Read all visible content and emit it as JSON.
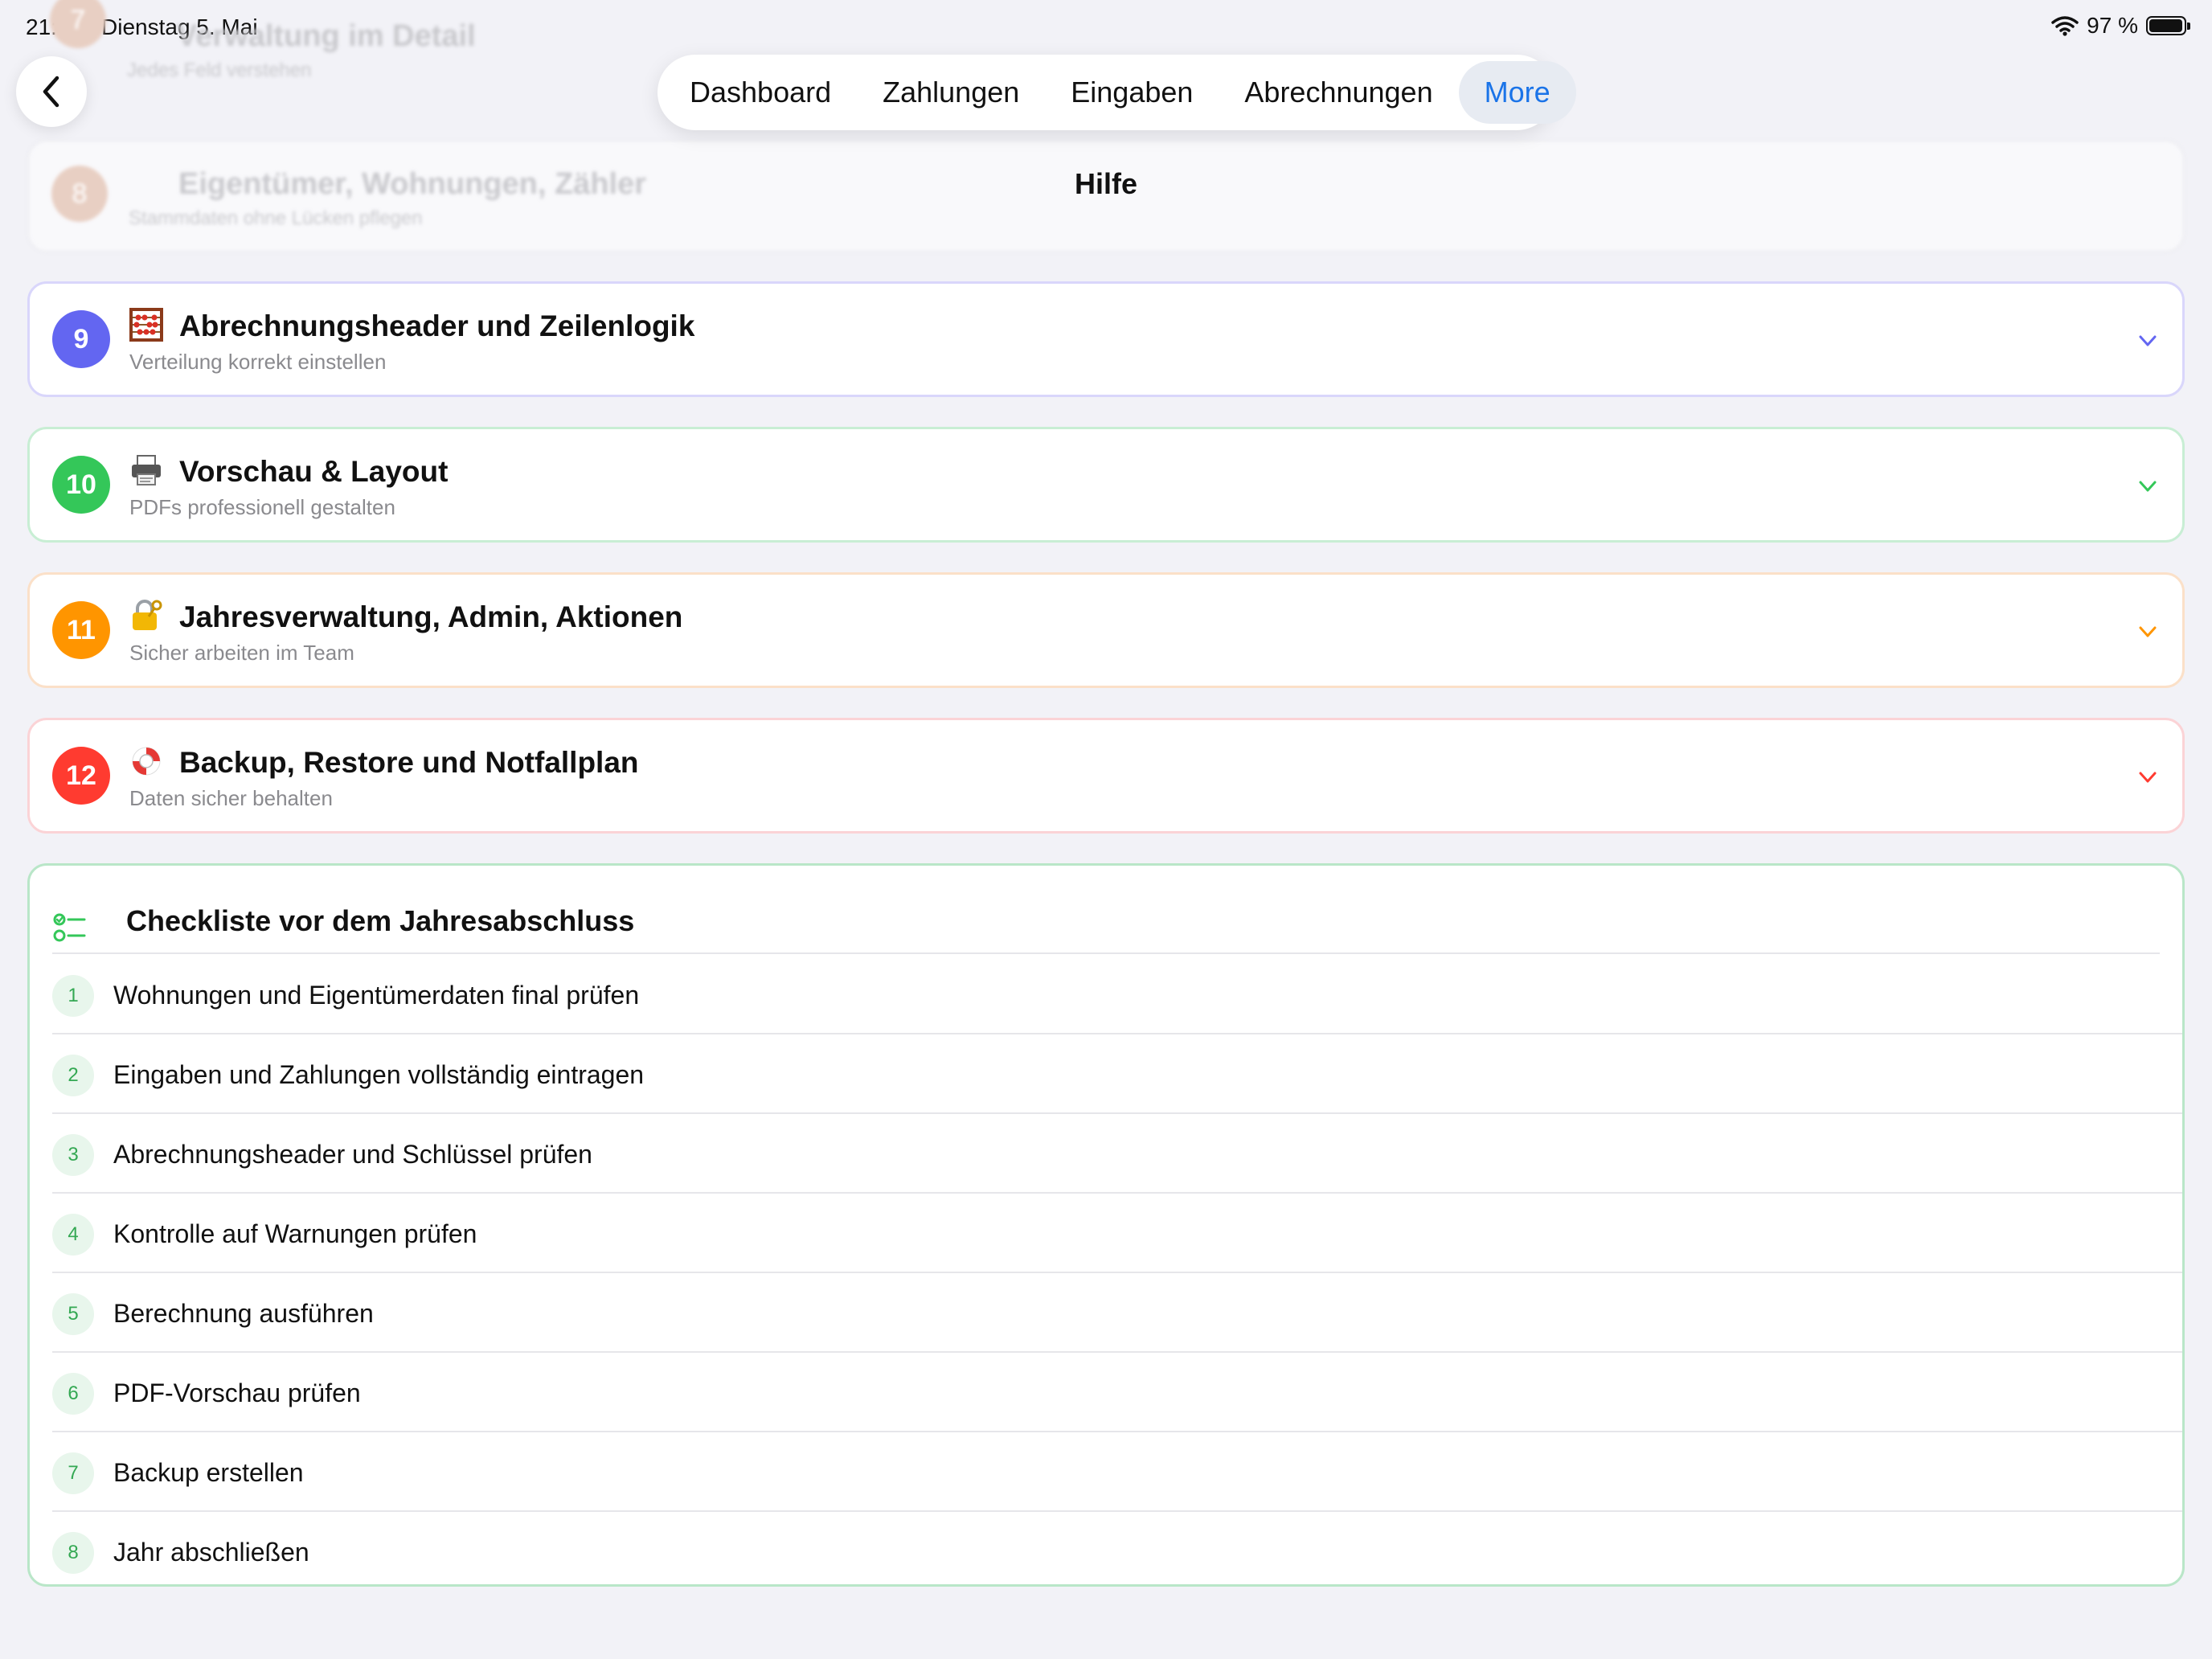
{
  "status": {
    "time": "21:58",
    "date": "Dienstag 5. Mai",
    "battery": "97 %",
    "battery_level": 0.97
  },
  "tabs": [
    {
      "label": "Dashboard"
    },
    {
      "label": "Zahlungen"
    },
    {
      "label": "Eingaben"
    },
    {
      "label": "Abrechnungen"
    },
    {
      "label": "More",
      "active": true
    }
  ],
  "page": {
    "title": "Hilfe"
  },
  "ghost_sections": [
    {
      "number": "7",
      "title": "Verwaltung im Detail",
      "subtitle": "Jedes Feld verstehen"
    },
    {
      "number": "8",
      "title": "Eigentümer, Wohnungen, Zähler",
      "subtitle": "Stammdaten ohne Lücken pflegen"
    }
  ],
  "sections": [
    {
      "number": "9",
      "icon": "abacus-icon",
      "title": "Abrechnungsheader und Zeilenlogik",
      "subtitle": "Verteilung korrekt einstellen",
      "color": "#6366f1",
      "border": "#d9d6fb"
    },
    {
      "number": "10",
      "icon": "printer-icon",
      "title": "Vorschau & Layout",
      "subtitle": "PDFs professionell gestalten",
      "color": "#34c759",
      "border": "#c8eed4"
    },
    {
      "number": "11",
      "icon": "lock-key-icon",
      "title": "Jahresverwaltung, Admin, Aktionen",
      "subtitle": "Sicher arbeiten im Team",
      "color": "#ff9500",
      "border": "#fbe0c8"
    },
    {
      "number": "12",
      "icon": "lifebuoy-icon",
      "title": "Backup, Restore und Notfallplan",
      "subtitle": "Daten sicher behalten",
      "color": "#ff3b30",
      "border": "#fbd3d6"
    }
  ],
  "checklist": {
    "title": "Checkliste vor dem Jahresabschluss",
    "items": [
      {
        "number": "1",
        "text": "Wohnungen und Eigentümerdaten final prüfen"
      },
      {
        "number": "2",
        "text": "Eingaben und Zahlungen vollständig eintragen"
      },
      {
        "number": "3",
        "text": "Abrechnungsheader und Schlüssel prüfen"
      },
      {
        "number": "4",
        "text": "Kontrolle auf Warnungen prüfen"
      },
      {
        "number": "5",
        "text": "Berechnung ausführen"
      },
      {
        "number": "6",
        "text": "PDF-Vorschau prüfen"
      },
      {
        "number": "7",
        "text": "Backup erstellen"
      },
      {
        "number": "8",
        "text": "Jahr abschließen"
      }
    ]
  }
}
